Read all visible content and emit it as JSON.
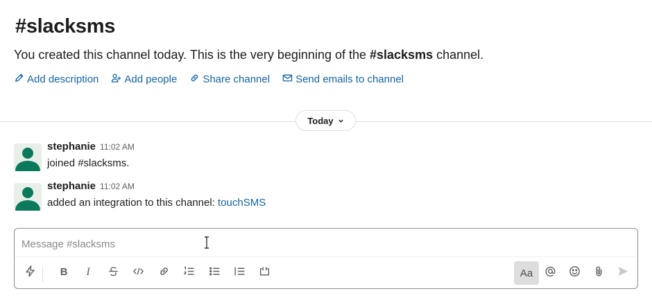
{
  "channel": {
    "title": "#slacksms",
    "intro_prefix": "You created this channel today. This is the very beginning of the ",
    "intro_channel": "#slacksms",
    "intro_suffix": " channel."
  },
  "actions": [
    {
      "label": "Add description",
      "icon": "pencil-icon"
    },
    {
      "label": "Add people",
      "icon": "add-person-icon"
    },
    {
      "label": "Share channel",
      "icon": "link-icon"
    },
    {
      "label": "Send emails to channel",
      "icon": "email-icon"
    }
  ],
  "divider": {
    "label": "Today"
  },
  "messages": [
    {
      "author": "stephanie",
      "time": "11:02 AM",
      "text": "joined #slacksms.",
      "link": ""
    },
    {
      "author": "stephanie",
      "time": "11:02 AM",
      "text": "added an integration to this channel: ",
      "link": "touchSMS"
    }
  ],
  "composer": {
    "placeholder": "Message #slacksms",
    "format_toggle_label": "Aa"
  },
  "colors": {
    "link": "#1264a3",
    "avatar": "#0b7a5c"
  }
}
